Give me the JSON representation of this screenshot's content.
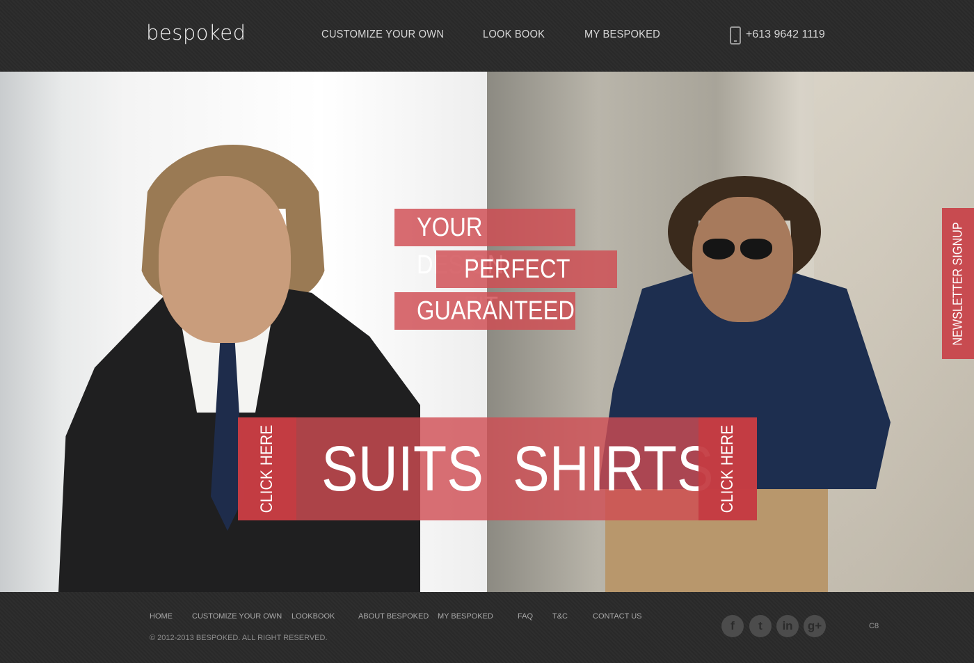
{
  "header": {
    "logo": "bespoked",
    "nav": [
      "CUSTOMIZE YOUR OWN",
      "LOOK BOOK",
      "MY BESPOKED"
    ],
    "phone": "+613 9642 1119"
  },
  "hero": {
    "taglines": [
      "YOUR DESIGN",
      "PERFECT FIT",
      "GUARANTEED"
    ],
    "suits": {
      "label": "SUITS",
      "cta": "CLICK HERE"
    },
    "shirts": {
      "label": "SHIRTS",
      "cta": "CLICK HERE"
    }
  },
  "newsletter": {
    "label": "NEWSLETTER SIGNUP"
  },
  "footer": {
    "links": [
      "HOME",
      "CUSTOMIZE YOUR OWN",
      "LOOKBOOK",
      "ABOUT BESPOKED",
      "MY BESPOKED",
      "FAQ",
      "T&C",
      "CONTACT US"
    ],
    "copyright": "© 2012-2013 BESPOKED. ALL RIGHT RESERVED.",
    "social": [
      {
        "icon": "facebook-icon",
        "glyph": "f"
      },
      {
        "icon": "twitter-icon",
        "glyph": "t"
      },
      {
        "icon": "linkedin-icon",
        "glyph": "in"
      },
      {
        "icon": "google-plus-icon",
        "glyph": "g+"
      }
    ],
    "credit": "C8"
  },
  "colors": {
    "accent": "#d04c52",
    "header_bg": "#2b2b2b",
    "text_light": "#d6d6d6"
  }
}
